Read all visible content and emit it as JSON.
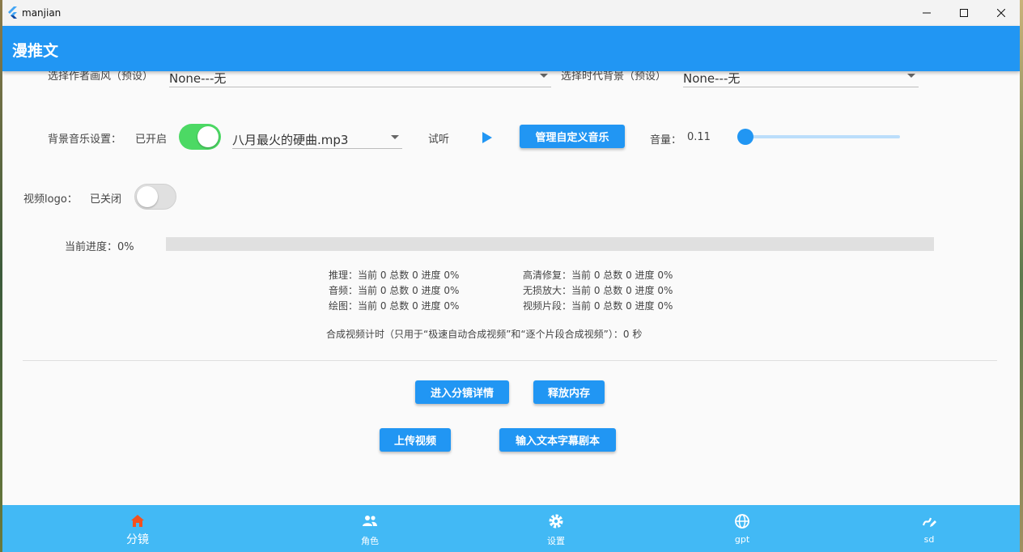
{
  "window": {
    "title": "manjian"
  },
  "appbar": {
    "title": "漫推文"
  },
  "style_row": {
    "artist_label": "选择作者画风（预设）",
    "artist_value": "None---无",
    "era_label": "选择时代背景（预设）",
    "era_value": "None---无"
  },
  "music": {
    "label": "背景音乐设置：",
    "status": "已开启",
    "enabled": true,
    "track": "八月最火的硬曲.mp3",
    "preview_label": "试听",
    "manage_button": "管理自定义音乐",
    "volume_label": "音量：",
    "volume_value": "0.11",
    "volume_level": 0.11
  },
  "logo": {
    "label": "视频logo：",
    "status": "已关闭",
    "enabled": false
  },
  "progress": {
    "label": "当前进度：",
    "value_text": "0%",
    "percent": 0
  },
  "stats": {
    "inference": "推理：当前 0 总数 0 进度 0%",
    "audio": "音频：当前 0 总数 0 进度 0%",
    "drawing": "绘图：当前 0 总数 0 进度 0%",
    "hd_repair": "高清修复：当前 0 总数 0 进度 0%",
    "lossless": "无损放大：当前 0 总数 0 进度 0%",
    "clips": "视频片段：当前 0 总数 0 进度 0%",
    "timer": "合成视频计时（只用于“极速自动合成视频”和“逐个片段合成视频”）：0 秒"
  },
  "actions": {
    "enter_details": "进入分镜详情",
    "release_memory": "释放内存",
    "upload_video": "上传视频",
    "input_script": "输入文本字幕剧本"
  },
  "bottom_nav": [
    {
      "label": "分镜",
      "icon": "home-icon",
      "active": true
    },
    {
      "label": "角色",
      "icon": "people-icon",
      "active": false
    },
    {
      "label": "设置",
      "icon": "gear-icon",
      "active": false
    },
    {
      "label": "gpt",
      "icon": "globe-icon",
      "active": false
    },
    {
      "label": "sd",
      "icon": "draw-icon",
      "active": false
    }
  ],
  "colors": {
    "primary": "#2196f3",
    "switch_on": "#4cd964",
    "nav_background": "#42b9f5",
    "nav_active_icon": "#f4511e"
  }
}
